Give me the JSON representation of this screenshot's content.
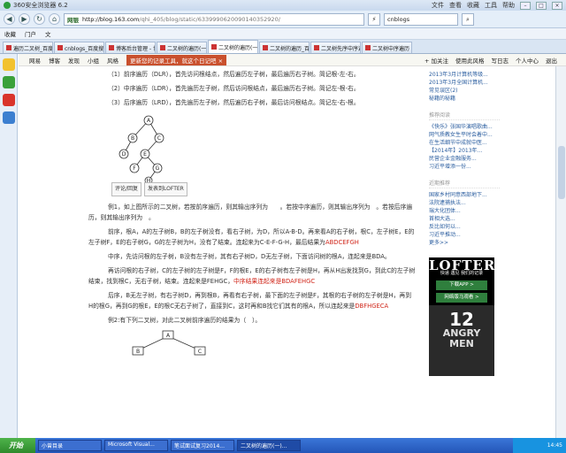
{
  "browser": {
    "title": "360安全浏览器 6.2",
    "menu": [
      "文件",
      "查看",
      "收藏",
      "工具",
      "帮助"
    ],
    "mode": "网银",
    "url_host": "http://blog.163.com",
    "url_path": "/qhi_405/blog/static/6339990620090140352920/",
    "search_value": "cnblogs",
    "favorites": [
      "收藏",
      "门户",
      "文"
    ]
  },
  "tabs": [
    {
      "label": "遍历二叉树_百度"
    },
    {
      "label": "cnblogs_百度搜索"
    },
    {
      "label": "博客后台管理 - 博"
    },
    {
      "label": "二叉树的遍历(一)"
    },
    {
      "label": "二叉树的遍历(一)",
      "active": true
    },
    {
      "label": "二叉树的遍历_百度"
    },
    {
      "label": "二叉树先序中序遍"
    },
    {
      "label": "二叉树中序遍历"
    }
  ],
  "blogbar": {
    "links": [
      "网易",
      "博客",
      "发现",
      "小组",
      "风格"
    ],
    "notice": "更新您的记录工具，就这个日记吧 ×",
    "right": [
      "+ 加关注",
      "使用此风格",
      "写日志",
      "个人中心",
      "退出"
    ]
  },
  "content": {
    "trav1": "（1）前序遍历（DLR），首先访问根结点，然后遍历左子树，最后遍历右子树。简记根-左-右。",
    "trav2": "（2）中序遍历（LDR），首先遍历左子树，然后访问根结点，最后遍历右子树。简记左-根-右。",
    "trav3": "（3）后序遍历（LRD），首先遍历左子树，然后遍历右子树，最后访问根结点。简记左-右-根。",
    "tree_nodes": [
      "A",
      "B",
      "C",
      "D",
      "E",
      "F",
      "G",
      "H"
    ],
    "img_btn1": "评论/回复",
    "img_btn2": "发表到LOFTER",
    "example1": "例1，如上图所示的二叉树，若按前序遍历，则其输出序列为　　。若按中序遍历，则其输出序列为　。若按后序遍历，则其输出序列为　。",
    "pre": "前序，根A，A的左子树B，B的左子树没有，看右子树，为D，所以A-B-D。再来看A的右子树，根C，左子树E，E的左子树F，E的右子树G，G的左子树为H，没有了结束。连起来为C-E-F-G-H，最后结果为",
    "pre_result": "ABDCEFGH",
    "in": "中序，先访问根的左子树，B没有左子树，其有右子树D，D无左子树，下面访问树的根A，连起来是BDA。",
    "post_lead": "再访问根的右子树，C的左子树的左子树是F，F的根E，E的右子树有左子树是H，再从H出发找到G，到此C的左子树结束，找到根C，无右子树，结束。连起来是FEHGC，",
    "post_red": "中序结果连起来是",
    "post_result": "BDAFEHGC",
    "post2": "后序，B无左子树，有右子树D，再到根B，再看有右子树，最下面的左子树是F，其根的右子树的左子树是H，再到H的根G，再到G的根E，E的根C无右子树了，直接到C，这时再和B找它们其有的根A，所以连起来是",
    "post2_result": "DBFHGECA",
    "example2": "例2:有下列二叉树，对此二叉树前序遍历的结果为（　）。",
    "tree2_nodes": [
      "A",
      "B",
      "C"
    ]
  },
  "right": {
    "recent": [
      "2013年3月计算机等级...",
      "2013年3月全国计算机...",
      "常见误区(2)",
      "秘籍的秘籍"
    ],
    "sec1": "推荐阅读",
    "reads": [
      "《快乐》张国华演唱歌曲...",
      "网气质教女生平时会着中...",
      "在生活细节中成就中医...",
      "【2014年】2013年...",
      "民营企业金融服务...",
      "习近平增添一份... "
    ],
    "sec2": "近期推荐",
    "near": [
      "国家乡村同意西部地下...",
      "法院逮捕执法...",
      "瑞大化团体...",
      "首相大选...",
      "反比如何以...",
      "习近平推动..."
    ],
    "more": "更多>>",
    "ad_brand": "LOFTER",
    "ad_slogan": "快递  遇见  我们的记录",
    "ad_cta1": "下载APP >",
    "ad_cta2": "网络版马观看 >",
    "ad_num": "12",
    "ad_t1": "ANGRY",
    "ad_t2": "MEN"
  },
  "taskbar": {
    "start": "开始",
    "items": [
      "小曾目录",
      "Microsoft Visual...",
      "笔试面试复习2014...",
      "二叉树的遍历(一)..."
    ],
    "clock": "14:45"
  }
}
